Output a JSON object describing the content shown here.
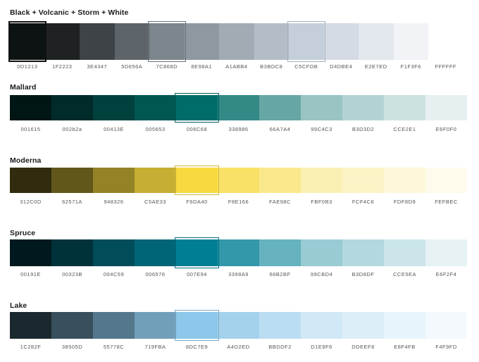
{
  "palettes": [
    {
      "name": "Black + Volcanic + Storm + White",
      "highlighted": [
        0,
        4,
        8
      ],
      "swatches": [
        {
          "hex": "0D1213",
          "label": "0D1213"
        },
        {
          "hex": "1F2223",
          "label": "1F2223"
        },
        {
          "hex": "3E4347",
          "label": "3E4347"
        },
        {
          "hex": "5D656A",
          "label": "5D656A"
        },
        {
          "hex": "7C868D",
          "label": "7C868D"
        },
        {
          "hex": "8E98A1",
          "label": "8E98A1"
        },
        {
          "hex": "A1ABB4",
          "label": "A1ABB4"
        },
        {
          "hex": "B3BDC8",
          "label": "B3BDC8"
        },
        {
          "hex": "C5CFDB",
          "label": "C5CFDB"
        },
        {
          "hex": "D4DBE4",
          "label": "D4DBE4"
        },
        {
          "hex": "E2E7ED",
          "label": "E2E7ED"
        },
        {
          "hex": "F1F3F6",
          "label": "F1F3F6"
        },
        {
          "hex": "FFFFFF",
          "label": "FFFFFF"
        }
      ]
    },
    {
      "name": "Mallard",
      "highlighted": [
        4
      ],
      "swatches": [
        {
          "hex": "001615",
          "label": "001615"
        },
        {
          "hex": "002b2a",
          "label": "002b2a"
        },
        {
          "hex": "00413E",
          "label": "00413E"
        },
        {
          "hex": "005653",
          "label": "005653"
        },
        {
          "hex": "006C68",
          "label": "006C68"
        },
        {
          "hex": "338986",
          "label": "338986"
        },
        {
          "hex": "66A7A4",
          "label": "66A7A4"
        },
        {
          "hex": "99C4C3",
          "label": "99C4C3"
        },
        {
          "hex": "B3D3D2",
          "label": "B3D3D2"
        },
        {
          "hex": "CCE2E1",
          "label": "CCE2E1"
        },
        {
          "hex": "E6F0F0",
          "label": "E6F0F0"
        }
      ]
    },
    {
      "name": "Moderna",
      "highlighted": [
        4
      ],
      "swatches": [
        {
          "hex": "312C0D",
          "label": "312C0D"
        },
        {
          "hex": "62571A",
          "label": "62571A"
        },
        {
          "hex": "948326",
          "label": "948326"
        },
        {
          "hex": "C5AE33",
          "label": "C5AE33"
        },
        {
          "hex": "F6DA40",
          "label": "F6DA40"
        },
        {
          "hex": "F8E166",
          "label": "F8E166"
        },
        {
          "hex": "FAE98C",
          "label": "FAE98C"
        },
        {
          "hex": "FBF0B3",
          "label": "FBF0B3"
        },
        {
          "hex": "FCF4C6",
          "label": "FCF4C6"
        },
        {
          "hex": "FDF8D9",
          "label": "FDF8D9"
        },
        {
          "hex": "FEFBEC",
          "label": "FEFBEC"
        }
      ]
    },
    {
      "name": "Spruce",
      "highlighted": [
        4
      ],
      "swatches": [
        {
          "hex": "00191E",
          "label": "00191E"
        },
        {
          "hex": "00323B",
          "label": "00323B"
        },
        {
          "hex": "004C59",
          "label": "004C59"
        },
        {
          "hex": "006576",
          "label": "006576"
        },
        {
          "hex": "007E94",
          "label": "007E94"
        },
        {
          "hex": "3398A9",
          "label": "3398A9"
        },
        {
          "hex": "66B2BF",
          "label": "66B2BF"
        },
        {
          "hex": "99CBD4",
          "label": "99CBD4"
        },
        {
          "hex": "B3D8DF",
          "label": "B3D8DF"
        },
        {
          "hex": "CCE5EA",
          "label": "CCE5EA"
        },
        {
          "hex": "E6F2F4",
          "label": "E6F2F4"
        }
      ]
    },
    {
      "name": "Lake",
      "highlighted": [
        4
      ],
      "swatches": [
        {
          "hex": "1C282F",
          "label": "1C282F"
        },
        {
          "hex": "38505D",
          "label": "38505D"
        },
        {
          "hex": "55778C",
          "label": "55778C"
        },
        {
          "hex": "719FBA",
          "label": "719FBA"
        },
        {
          "hex": "8DC7E9",
          "label": "8DC7E9"
        },
        {
          "hex": "A4D2ED",
          "label": "A4D2ED"
        },
        {
          "hex": "BBDDF2",
          "label": "BBDDF2"
        },
        {
          "hex": "D1E9F6",
          "label": "D1E9F6"
        },
        {
          "hex": "DDEEF8",
          "label": "DDEEF8"
        },
        {
          "hex": "E8F4FB",
          "label": "E8F4FB"
        },
        {
          "hex": "F4F9FD",
          "label": "F4F9FD"
        }
      ]
    }
  ]
}
